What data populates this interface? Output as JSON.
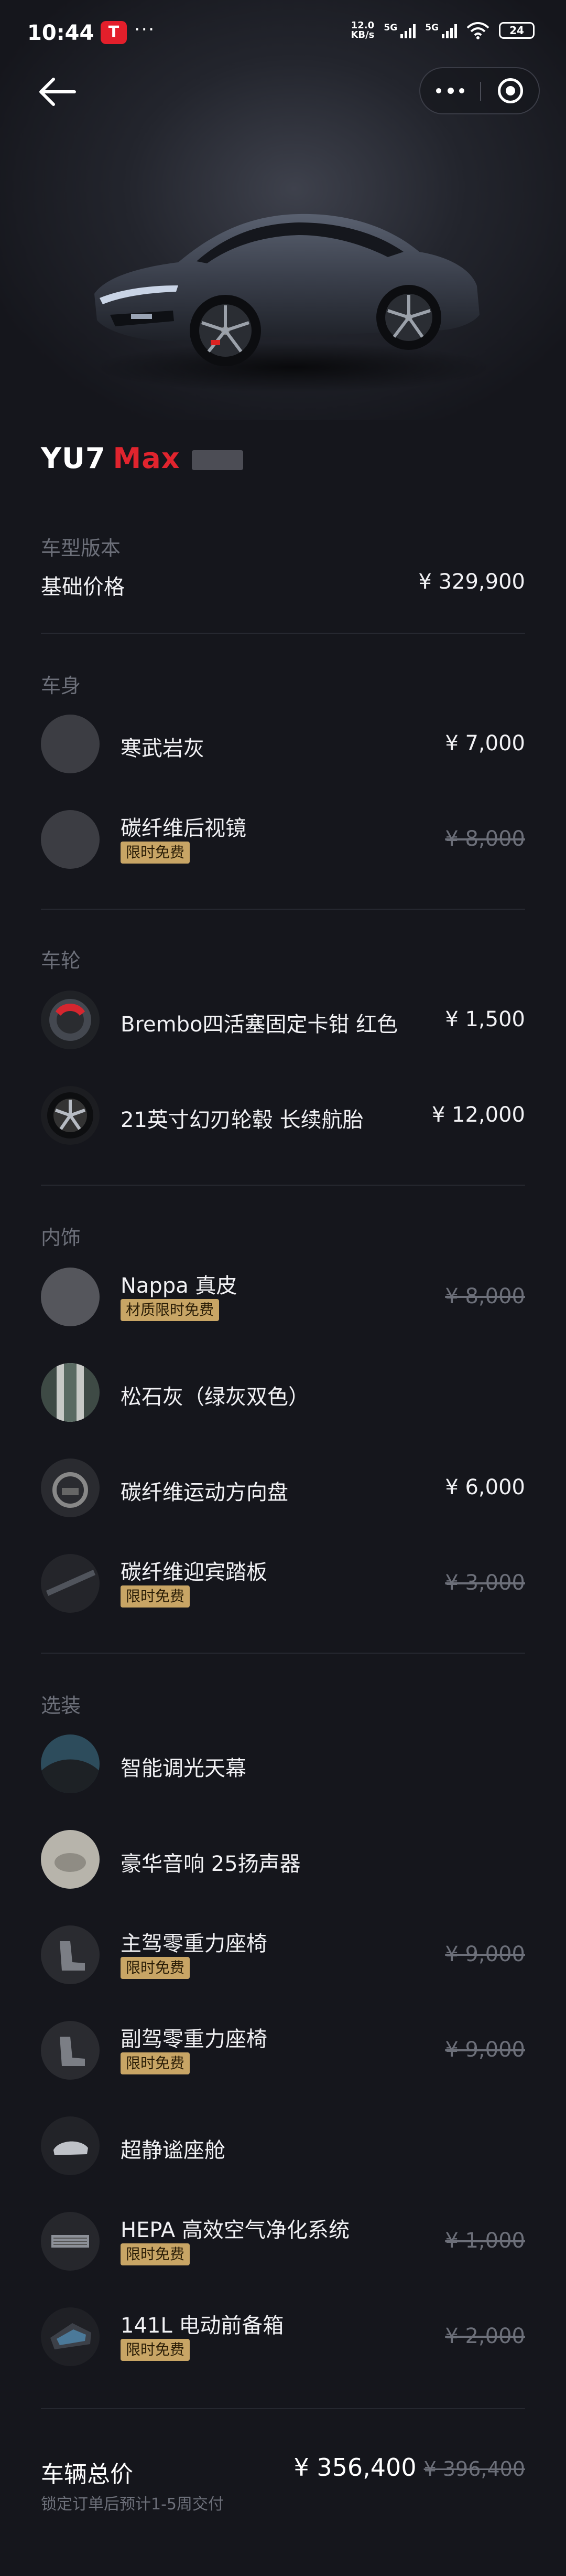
{
  "status_bar": {
    "time": "10:44",
    "app_badge": "T",
    "more": "···",
    "speed_value": "12.0",
    "speed_unit": "KB/s",
    "net1": "5G",
    "net2": "5G",
    "battery": "24"
  },
  "model": {
    "name_part1": "YU7",
    "name_part2": "Max"
  },
  "base": {
    "section": "车型版本",
    "label": "基础价格",
    "price": "¥ 329,900"
  },
  "sections": {
    "body": "车身",
    "wheels": "车轮",
    "interior": "内饰",
    "options": "选装"
  },
  "items": {
    "color": {
      "label": "寒武岩灰",
      "price": "¥ 7,000"
    },
    "mirror": {
      "label": "碳纤维后视镜",
      "price": "¥ 8,000",
      "tag": "限时免费"
    },
    "caliper": {
      "label": "Brembo四活塞固定卡钳 红色",
      "price": "¥ 1,500"
    },
    "rims": {
      "label": "21英寸幻刃轮毂 长续航胎",
      "price": "¥ 12,000"
    },
    "nappa": {
      "label": "Nappa 真皮",
      "price": "¥ 8,000",
      "tag": "材质限时免费"
    },
    "pine": {
      "label": "松石灰（绿灰双色）"
    },
    "wheel": {
      "label": "碳纤维运动方向盘",
      "price": "¥ 6,000"
    },
    "sill": {
      "label": "碳纤维迎宾踏板",
      "price": "¥ 3,000",
      "tag": "限时免费"
    },
    "roof": {
      "label": "智能调光天幕"
    },
    "audio": {
      "label": "豪华音响 25扬声器"
    },
    "driver_seat": {
      "label": "主驾零重力座椅",
      "price": "¥ 9,000",
      "tag": "限时免费"
    },
    "pass_seat": {
      "label": "副驾零重力座椅",
      "price": "¥ 9,000",
      "tag": "限时免费"
    },
    "quiet": {
      "label": "超静谧座舱"
    },
    "hepa": {
      "label": "HEPA 高效空气净化系统",
      "price": "¥ 1,000",
      "tag": "限时免费"
    },
    "frunk": {
      "label": "141L 电动前备箱",
      "price": "¥ 2,000",
      "tag": "限时免费"
    }
  },
  "total": {
    "label": "车辆总价",
    "price": "¥ 356,400",
    "old_price": "¥ 396,400",
    "note": "锁定订单后预计1-5周交付"
  },
  "colors": {
    "accent_red": "#e0242e",
    "tag_gold": "#c8a565",
    "bg": "#15161c"
  }
}
